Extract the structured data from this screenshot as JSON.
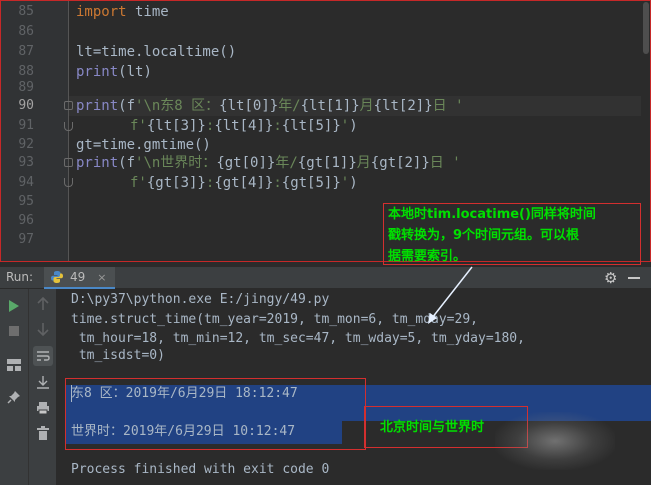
{
  "editor": {
    "line_numbers": [
      "85",
      "86",
      "87",
      "88",
      "89",
      "90",
      "91",
      "92",
      "93",
      "94",
      "95",
      "96",
      "97"
    ],
    "lines": {
      "l85": {
        "kw": "import",
        "rest": " time"
      },
      "l87": "lt=time.localtime()",
      "l88": {
        "bi": "print",
        "rest": "(lt)"
      },
      "l90": {
        "bi": "print",
        "open": "(f",
        "str1": "'\\n东8 区：",
        "expr1": "{lt[0]}",
        "str2": "年/",
        "expr2": "{lt[1]}",
        "str3": "月",
        "expr3": "{lt[2]}",
        "str4": "日 '"
      },
      "l91": {
        "str0": "f'",
        "expr1": "{lt[3]}",
        "sep1": ":",
        "expr2": "{lt[4]}",
        "sep2": ":",
        "expr3": "{lt[5]}",
        "end": "'",
        "close": ")"
      },
      "l92": "gt=time.gmtime()",
      "l93": {
        "bi": "print",
        "open": "(f",
        "str1": "'\\n世界时：",
        "expr1": "{gt[0]}",
        "str2": "年/",
        "expr2": "{gt[1]}",
        "str3": "月",
        "expr3": "{gt[2]}",
        "str4": "日 '"
      },
      "l94": {
        "str0": "f'",
        "expr1": "{gt[3]}",
        "sep1": ":",
        "expr2": "{gt[4]}",
        "sep2": ":",
        "expr3": "{gt[5]}",
        "end": "'",
        "close": ")"
      }
    }
  },
  "run": {
    "label": "Run:",
    "tab_label": "49",
    "tab_close": "×",
    "gear": "⚙"
  },
  "console": {
    "cmd": "D:\\py37\\python.exe E:/jingy/49.py",
    "struct1": "time.struct_time(tm_year=2019, tm_mon=6, tm_mday=29,",
    "struct2": " tm_hour=18, tm_min=12, tm_sec=47, tm_wday=5, tm_yday=180,",
    "struct3": " tm_isdst=0)",
    "local_time": "东8 区：2019年/6月29日 18:12:47",
    "world_time": "世界时：2019年/6月29日 10:12:47",
    "exit": "Process finished with exit code 0"
  },
  "annotations": {
    "note1_line1": "本地时tim.locatime()同样将时间",
    "note1_line2": "戳转换为，9个时间元组。可以根",
    "note1_line3": "据需要索引。",
    "note2": "北京时间与世界时"
  },
  "colors": {
    "keyword": "#cc7832",
    "builtin": "#8888c6",
    "string": "#6a8759",
    "text": "#a9b7c6",
    "selection": "#214283",
    "annotation": "#00e000",
    "annotation_border": "#d32f2f"
  }
}
